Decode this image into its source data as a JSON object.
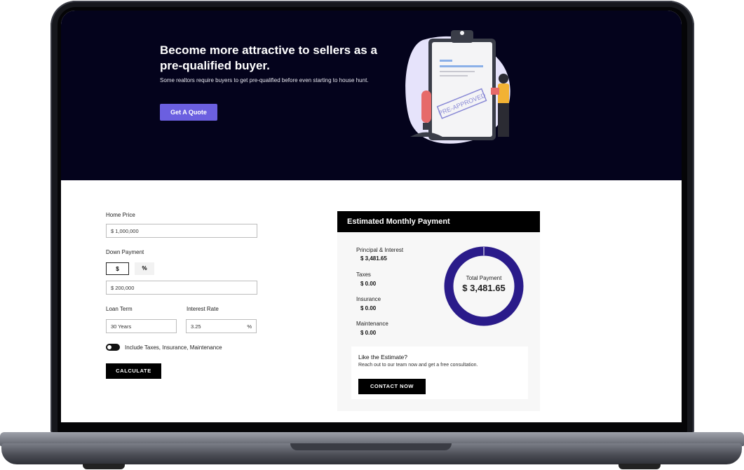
{
  "hero": {
    "title": "Become more attractive to sellers as a pre-qualified buyer.",
    "subtitle": "Some realtors require buyers to get pre-qualified before even starting to house hunt.",
    "quote_button": "Get A Quote",
    "stamp_text": "PRE-APPROVED"
  },
  "form": {
    "home_price_label": "Home Price",
    "home_price_value": "$ 1,000,000",
    "down_payment_label": "Down Payment",
    "down_toggle_dollar": "$",
    "down_toggle_percent": "%",
    "down_payment_value": "$ 200,000",
    "loan_term_label": "Loan Term",
    "loan_term_value": "30 Years",
    "interest_rate_label": "Interest Rate",
    "interest_rate_value": "3.25",
    "interest_rate_unit": "%",
    "include_label": "Include Taxes, Insurance, Maintenance",
    "calculate_button": "CALCULATE"
  },
  "estimate": {
    "header": "Estimated Monthly Payment",
    "items": [
      {
        "label": "Principal & Interest",
        "value": "$ 3,481.65"
      },
      {
        "label": "Taxes",
        "value": "$ 0.00"
      },
      {
        "label": "Insurance",
        "value": "$ 0.00"
      },
      {
        "label": "Maintenance",
        "value": "$ 0.00"
      }
    ],
    "total_label": "Total Payment",
    "total_value": "$ 3,481.65",
    "cta_title": "Like the Estimate?",
    "cta_text": "Reach out to our team now and get a free consultation.",
    "contact_button": "CONTACT NOW"
  },
  "colors": {
    "hero_bg": "#04031c",
    "accent": "#6b5fe0",
    "donut": "#2a1b8a"
  }
}
